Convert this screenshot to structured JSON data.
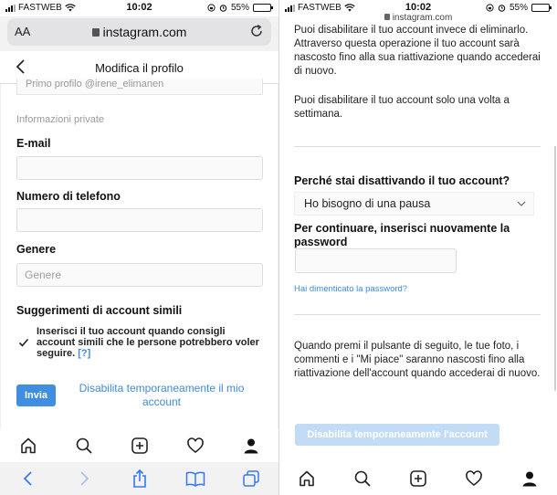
{
  "status": {
    "carrier": "FASTWEB",
    "time": "10:02",
    "battery": "55%",
    "battery_level": 0.55
  },
  "left": {
    "url_aa": "AA",
    "url_domain": "instagram.com",
    "header_title": "Modifica il profilo",
    "prev_field_text": "Primo profilo @irene_elimanen",
    "private_info_label": "Informazioni private",
    "email_label": "E-mail",
    "email_value": "",
    "phone_label": "Numero di telefono",
    "phone_value": "",
    "gender_label": "Genere",
    "gender_placeholder": "Genere",
    "suggestions_label": "Suggerimenti di account simili",
    "suggestions_text": "Inserisci il tuo account quando consigli account simili che le persone potrebbero voler seguire.",
    "suggestions_help": "[?]",
    "send_button": "Invia",
    "disable_link": "Disabilita temporaneamente il mio account"
  },
  "right": {
    "url_domain": "instagram.com",
    "intro_text": "Puoi disabilitare il tuo account invece di eliminarlo. Attraverso questa operazione il tuo account sarà nascosto fino alla sua riattivazione quando accederai di nuovo.",
    "once_week_text": "Puoi disabilitare il tuo account solo una volta a settimana.",
    "reason_question": "Perché stai disattivando il tuo account?",
    "reason_selected": "Ho bisogno di una pausa",
    "password_prompt": "Per continuare, inserisci nuovamente la password",
    "forgot_password": "Hai dimenticato la password?",
    "notice_text": "Quando premi il pulsante di seguito, le tue foto, i commenti e i \"Mi piace\" saranno nascosti fino alla riattivazione dell'account quando accederai di nuovo.",
    "disable_button": "Disabilita temporaneamente l'account"
  },
  "icons": {
    "ig_tabs": [
      "home-icon",
      "search-icon",
      "new-post-icon",
      "activity-heart-icon",
      "profile-icon"
    ],
    "safari_tabs": [
      "back-icon",
      "forward-icon",
      "share-icon",
      "bookmarks-icon",
      "tabs-icon"
    ]
  },
  "colors": {
    "accent": "#3f8ee0",
    "accent_disabled": "#c3dcf6",
    "safari_tint": "#3478f6"
  }
}
